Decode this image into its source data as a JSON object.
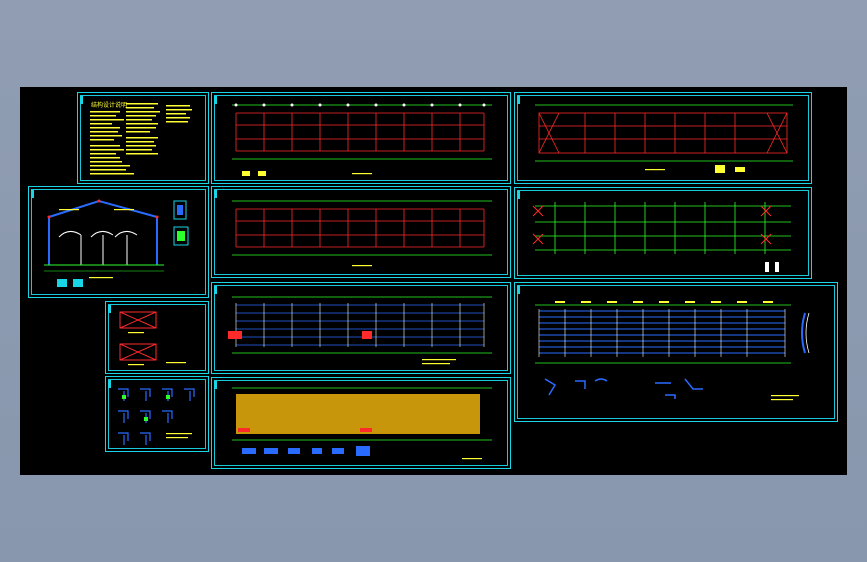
{
  "drawing": {
    "general_notes_title": "结构设计说明"
  },
  "colors": {
    "background": "#000000",
    "frame": "#19d6e6",
    "grid": "#ff2a2a",
    "axis": "#2cff2c",
    "beam": "#ffffff",
    "purlin": "#2a6bff",
    "roof_fill": "#c8960a",
    "text": "#ffff33"
  },
  "icons": {
    "sheet_stamp": "sheet-stamp-icon",
    "detail": "detail-icon"
  }
}
